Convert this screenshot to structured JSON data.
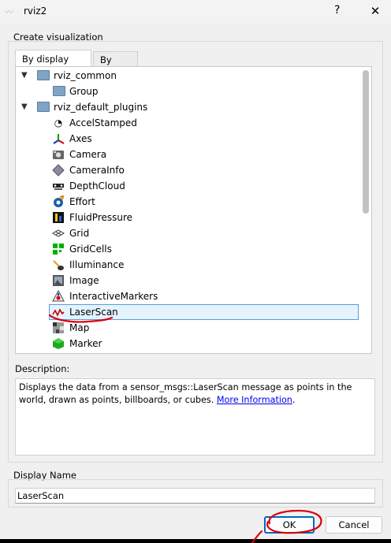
{
  "window": {
    "title": "rviz2",
    "help_glyph": "?",
    "close_glyph": "✕",
    "app_icon": "rviz-app-icon"
  },
  "create": {
    "group_title": "Create visualization",
    "tabs": [
      {
        "label": "By display type",
        "active": true
      },
      {
        "label": "By topic",
        "active": false
      }
    ],
    "tree": [
      {
        "label": "rviz_common",
        "kind": "folder",
        "expanded": true,
        "icon": "folder-icon"
      },
      {
        "label": "Group",
        "kind": "folder",
        "icon": "folder-icon"
      },
      {
        "label": "rviz_default_plugins",
        "kind": "folder",
        "expanded": true,
        "icon": "folder-icon"
      },
      {
        "label": "AccelStamped",
        "icon": "accel-icon"
      },
      {
        "label": "Axes",
        "icon": "axes-icon"
      },
      {
        "label": "Camera",
        "icon": "camera-icon"
      },
      {
        "label": "CameraInfo",
        "icon": "camera-info-icon"
      },
      {
        "label": "DepthCloud",
        "icon": "depth-cloud-icon"
      },
      {
        "label": "Effort",
        "icon": "effort-icon"
      },
      {
        "label": "FluidPressure",
        "icon": "fluid-pressure-icon"
      },
      {
        "label": "Grid",
        "icon": "grid-icon"
      },
      {
        "label": "GridCells",
        "icon": "grid-cells-icon"
      },
      {
        "label": "Illuminance",
        "icon": "illuminance-icon"
      },
      {
        "label": "Image",
        "icon": "image-icon"
      },
      {
        "label": "InteractiveMarkers",
        "icon": "interactive-markers-icon"
      },
      {
        "label": "LaserScan",
        "icon": "laser-scan-icon",
        "selected": true
      },
      {
        "label": "Map",
        "icon": "map-icon"
      },
      {
        "label": "Marker",
        "icon": "marker-icon"
      }
    ]
  },
  "description": {
    "label": "Description:",
    "text": "Displays the data from a sensor_msgs::LaserScan message as points in the world, drawn as points, billboards, or cubes.",
    "link_text": "More Information",
    "after_link": "."
  },
  "display_name": {
    "label": "Display Name",
    "value": "LaserScan"
  },
  "buttons": {
    "ok": "OK",
    "cancel": "Cancel"
  },
  "colors": {
    "selection_border": "#5b9bd5",
    "selection_fill": "#e5f3ff",
    "annotation": "#d9000d",
    "folder": "#7ea4c6"
  }
}
